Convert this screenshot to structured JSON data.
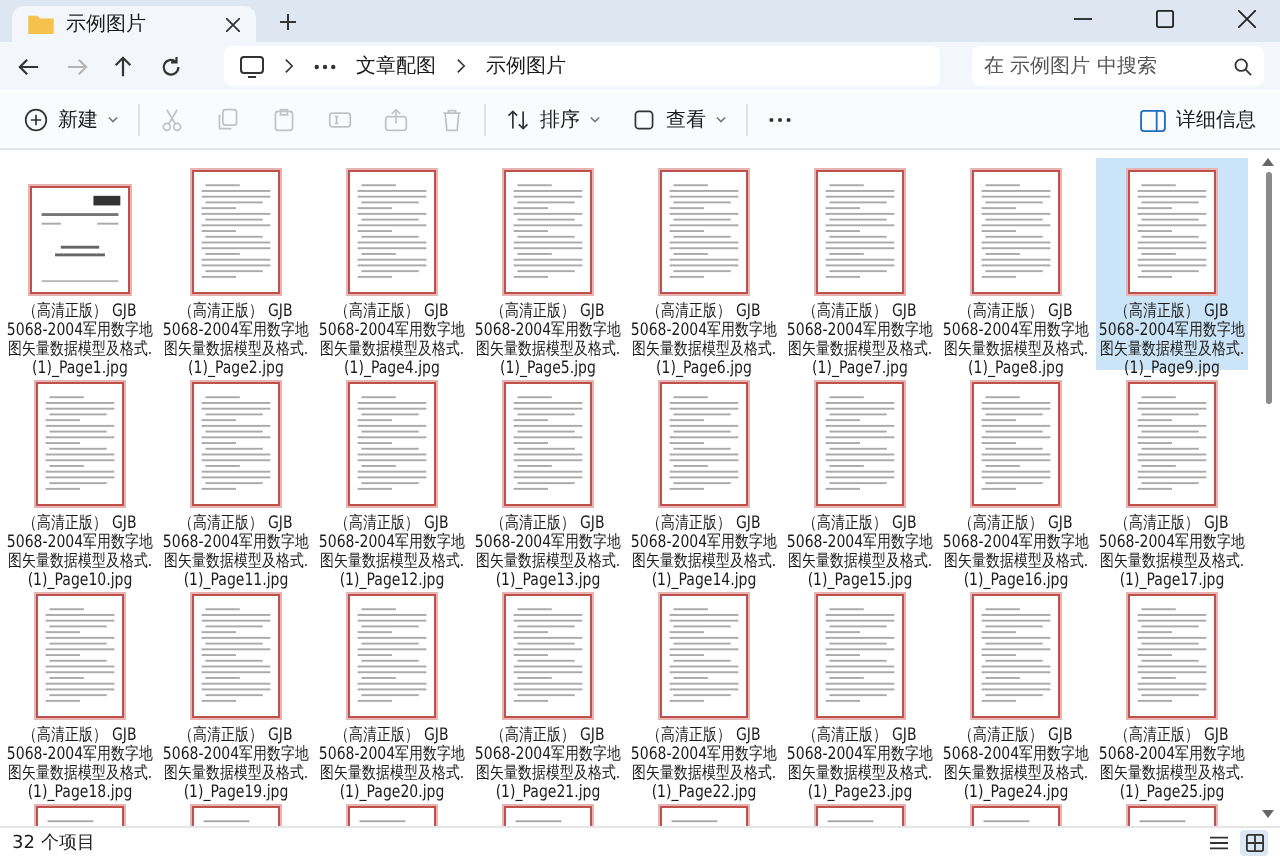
{
  "tabs": [
    {
      "title": "示例图片",
      "selected": true
    }
  ],
  "navigation": [
    {
      "kind": "back",
      "disabled": false
    },
    {
      "kind": "forward",
      "disabled": true
    },
    {
      "kind": "up",
      "disabled": false
    },
    {
      "kind": "refresh",
      "disabled": false
    }
  ],
  "breadcrumb": [
    "文章配图",
    "示例图片"
  ],
  "search": {
    "placeholder": "在 示例图片 中搜索"
  },
  "toolbar": [
    {
      "kind": "new",
      "label": "新建",
      "disabled": false
    },
    {
      "kind": "cut",
      "disabled": true
    },
    {
      "kind": "copy",
      "disabled": true
    },
    {
      "kind": "paste",
      "disabled": true
    },
    {
      "kind": "rename",
      "disabled": true
    },
    {
      "kind": "share",
      "disabled": true
    },
    {
      "kind": "delete",
      "disabled": true
    },
    {
      "kind": "sort",
      "label": "排序",
      "disabled": false
    },
    {
      "kind": "view",
      "label": "查看",
      "disabled": false
    },
    {
      "kind": "more",
      "disabled": false
    }
  ],
  "details_button": {
    "label": "详细信息"
  },
  "files": [
    {
      "kind": "cover",
      "selected": false,
      "name_lines": [
        "（高清正版） GJB",
        "5068-2004军用数字地",
        "图矢量数据模型及格式.",
        "(1)_Page1.jpg"
      ]
    },
    {
      "kind": "page",
      "selected": false,
      "name_lines": [
        "（高清正版） GJB",
        "5068-2004军用数字地",
        "图矢量数据模型及格式.",
        "(1)_Page2.jpg"
      ]
    },
    {
      "kind": "page",
      "selected": false,
      "name_lines": [
        "（高清正版） GJB",
        "5068-2004军用数字地",
        "图矢量数据模型及格式.",
        "(1)_Page4.jpg"
      ]
    },
    {
      "kind": "page",
      "selected": false,
      "name_lines": [
        "（高清正版） GJB",
        "5068-2004军用数字地",
        "图矢量数据模型及格式.",
        "(1)_Page5.jpg"
      ]
    },
    {
      "kind": "page",
      "selected": false,
      "name_lines": [
        "（高清正版） GJB",
        "5068-2004军用数字地",
        "图矢量数据模型及格式.",
        "(1)_Page6.jpg"
      ]
    },
    {
      "kind": "page",
      "selected": false,
      "name_lines": [
        "（高清正版） GJB",
        "5068-2004军用数字地",
        "图矢量数据模型及格式.",
        "(1)_Page7.jpg"
      ]
    },
    {
      "kind": "page",
      "selected": false,
      "name_lines": [
        "（高清正版） GJB",
        "5068-2004军用数字地",
        "图矢量数据模型及格式.",
        "(1)_Page8.jpg"
      ]
    },
    {
      "kind": "page",
      "selected": true,
      "name_lines": [
        "（高清正版） GJB",
        "5068-2004军用数字地",
        "图矢量数据模型及格式.",
        "(1)_Page9.jpg"
      ]
    },
    {
      "kind": "page",
      "selected": false,
      "name_lines": [
        "（高清正版） GJB",
        "5068-2004军用数字地",
        "图矢量数据模型及格式.",
        "(1)_Page10.jpg"
      ]
    },
    {
      "kind": "page",
      "selected": false,
      "name_lines": [
        "（高清正版） GJB",
        "5068-2004军用数字地",
        "图矢量数据模型及格式.",
        "(1)_Page11.jpg"
      ]
    },
    {
      "kind": "page",
      "selected": false,
      "name_lines": [
        "（高清正版） GJB",
        "5068-2004军用数字地",
        "图矢量数据模型及格式.",
        "(1)_Page12.jpg"
      ]
    },
    {
      "kind": "page",
      "selected": false,
      "name_lines": [
        "（高清正版） GJB",
        "5068-2004军用数字地",
        "图矢量数据模型及格式.",
        "(1)_Page13.jpg"
      ]
    },
    {
      "kind": "page",
      "selected": false,
      "name_lines": [
        "（高清正版） GJB",
        "5068-2004军用数字地",
        "图矢量数据模型及格式.",
        "(1)_Page14.jpg"
      ]
    },
    {
      "kind": "page",
      "selected": false,
      "name_lines": [
        "（高清正版） GJB",
        "5068-2004军用数字地",
        "图矢量数据模型及格式.",
        "(1)_Page15.jpg"
      ]
    },
    {
      "kind": "page",
      "selected": false,
      "name_lines": [
        "（高清正版） GJB",
        "5068-2004军用数字地",
        "图矢量数据模型及格式.",
        "(1)_Page16.jpg"
      ]
    },
    {
      "kind": "page",
      "selected": false,
      "name_lines": [
        "（高清正版） GJB",
        "5068-2004军用数字地",
        "图矢量数据模型及格式.",
        "(1)_Page17.jpg"
      ]
    },
    {
      "kind": "page",
      "selected": false,
      "name_lines": [
        "（高清正版） GJB",
        "5068-2004军用数字地",
        "图矢量数据模型及格式.",
        "(1)_Page18.jpg"
      ]
    },
    {
      "kind": "page",
      "selected": false,
      "name_lines": [
        "（高清正版） GJB",
        "5068-2004军用数字地",
        "图矢量数据模型及格式.",
        "(1)_Page19.jpg"
      ]
    },
    {
      "kind": "page",
      "selected": false,
      "name_lines": [
        "（高清正版） GJB",
        "5068-2004军用数字地",
        "图矢量数据模型及格式.",
        "(1)_Page20.jpg"
      ]
    },
    {
      "kind": "page",
      "selected": false,
      "name_lines": [
        "（高清正版） GJB",
        "5068-2004军用数字地",
        "图矢量数据模型及格式.",
        "(1)_Page21.jpg"
      ]
    },
    {
      "kind": "page",
      "selected": false,
      "name_lines": [
        "（高清正版） GJB",
        "5068-2004军用数字地",
        "图矢量数据模型及格式.",
        "(1)_Page22.jpg"
      ]
    },
    {
      "kind": "page",
      "selected": false,
      "name_lines": [
        "（高清正版） GJB",
        "5068-2004军用数字地",
        "图矢量数据模型及格式.",
        "(1)_Page23.jpg"
      ]
    },
    {
      "kind": "page",
      "selected": false,
      "name_lines": [
        "（高清正版） GJB",
        "5068-2004军用数字地",
        "图矢量数据模型及格式.",
        "(1)_Page24.jpg"
      ]
    },
    {
      "kind": "page",
      "selected": false,
      "name_lines": [
        "（高清正版） GJB",
        "5068-2004军用数字地",
        "图矢量数据模型及格式.",
        "(1)_Page25.jpg"
      ]
    }
  ],
  "partial_items": [
    {
      "selected": false
    },
    {
      "selected": false
    },
    {
      "selected": false
    },
    {
      "selected": false
    },
    {
      "selected": false
    },
    {
      "selected": false
    },
    {
      "selected": false
    },
    {
      "selected": false
    }
  ],
  "status_bar": {
    "item_count": "32 个项目",
    "views": [
      {
        "kind": "details",
        "selected": false
      },
      {
        "kind": "large-icons",
        "selected": true
      }
    ]
  }
}
